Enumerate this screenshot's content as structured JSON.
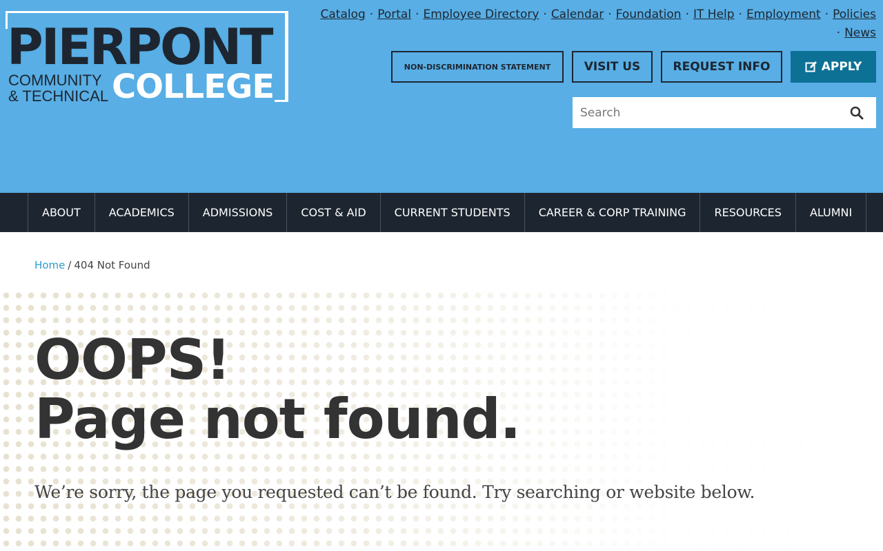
{
  "logo": {
    "main": "PIERPONT",
    "sub_line1": "COMMUNITY",
    "sub_line2": "& TECHNICAL",
    "college": "COLLEGE"
  },
  "utility_links": [
    "Catalog",
    "Portal",
    "Employee Directory",
    "Calendar",
    "Foundation",
    "IT Help",
    "Employment",
    "Policies",
    "News"
  ],
  "buttons": {
    "nondiscrimination": "NON-DISCRIMINATION STATEMENT",
    "visit": "VISIT US",
    "request": "REQUEST INFO",
    "apply": "APPLY"
  },
  "search": {
    "placeholder": "Search"
  },
  "nav": [
    "ABOUT",
    "ACADEMICS",
    "ADMISSIONS",
    "COST & AID",
    "CURRENT STUDENTS",
    "CAREER & CORP TRAINING",
    "RESOURCES",
    "ALUMNI"
  ],
  "breadcrumb": {
    "home": "Home",
    "current": "404 Not Found"
  },
  "hero": {
    "line1": "OOPS!",
    "line2": "Page not found.",
    "message": "We’re sorry, the page you requested can’t be found. Try searching or website below."
  },
  "colors": {
    "header_bg": "#58aee5",
    "nav_bg": "#1d2630",
    "apply_bg": "#0d7196",
    "link": "#2a9cc7"
  }
}
